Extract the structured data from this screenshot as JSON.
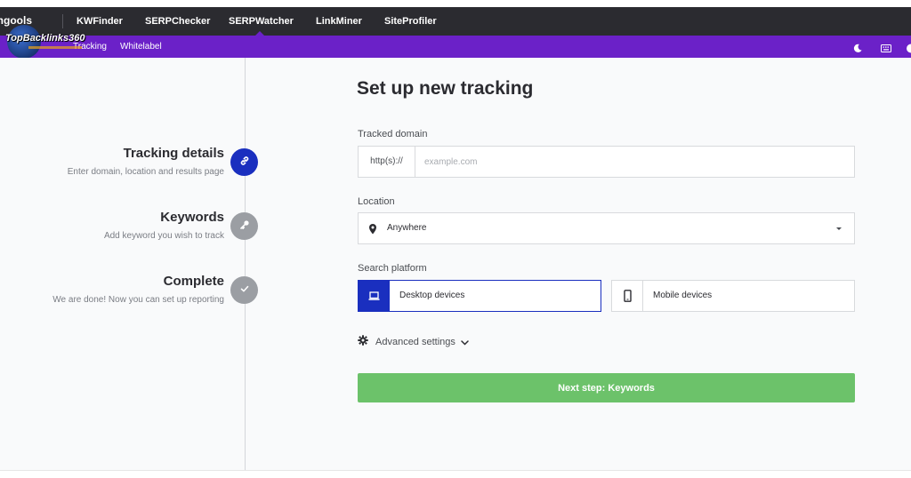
{
  "topnav": {
    "brand": "Mangools",
    "items": [
      "KWFinder",
      "SERPChecker",
      "SERPWatcher",
      "LinkMiner",
      "SiteProfiler"
    ],
    "active": "SERPWatcher"
  },
  "subnav": {
    "items": [
      "Tracking",
      "Whitelabel"
    ]
  },
  "watermark": {
    "text": "TopBacklinks360"
  },
  "steps": [
    {
      "title": "Tracking details",
      "description": "Enter domain, location and results page",
      "state": "active",
      "icon": "link-icon"
    },
    {
      "title": "Keywords",
      "description": "Add keyword you wish to track",
      "state": "inactive",
      "icon": "key-icon"
    },
    {
      "title": "Complete",
      "description": "We are done! Now you can set up reporting",
      "state": "inactive",
      "icon": "check-icon"
    }
  ],
  "form": {
    "title": "Set up new tracking",
    "domain": {
      "label": "Tracked domain",
      "prefix": "http(s)://",
      "placeholder": "example.com",
      "value": ""
    },
    "location": {
      "label": "Location",
      "value": "Anywhere"
    },
    "platform": {
      "label": "Search platform",
      "options": [
        {
          "label": "Desktop devices",
          "icon": "laptop-icon",
          "selected": true
        },
        {
          "label": "Mobile devices",
          "icon": "phone-icon",
          "selected": false
        }
      ]
    },
    "advanced_label": "Advanced settings",
    "next_label": "Next step: Keywords"
  },
  "colors": {
    "topbar": "#2b2b30",
    "subbar": "#6b21c8",
    "accent_blue": "#1a2fbf",
    "next_green": "#6cc26a",
    "inactive_step": "#9b9ea3"
  }
}
